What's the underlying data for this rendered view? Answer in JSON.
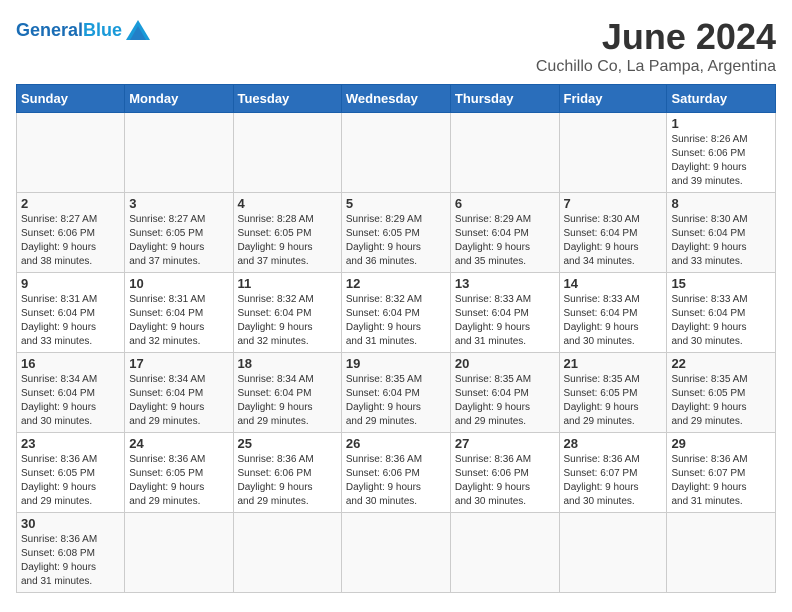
{
  "header": {
    "logo_general": "General",
    "logo_blue": "Blue",
    "month_title": "June 2024",
    "location": "Cuchillo Co, La Pampa, Argentina"
  },
  "days_of_week": [
    "Sunday",
    "Monday",
    "Tuesday",
    "Wednesday",
    "Thursday",
    "Friday",
    "Saturday"
  ],
  "weeks": [
    [
      {
        "day": "",
        "content": ""
      },
      {
        "day": "",
        "content": ""
      },
      {
        "day": "",
        "content": ""
      },
      {
        "day": "",
        "content": ""
      },
      {
        "day": "",
        "content": ""
      },
      {
        "day": "",
        "content": ""
      },
      {
        "day": "1",
        "content": "Sunrise: 8:26 AM\nSunset: 6:06 PM\nDaylight: 9 hours\nand 39 minutes."
      }
    ],
    [
      {
        "day": "2",
        "content": "Sunrise: 8:27 AM\nSunset: 6:06 PM\nDaylight: 9 hours\nand 38 minutes."
      },
      {
        "day": "3",
        "content": "Sunrise: 8:27 AM\nSunset: 6:05 PM\nDaylight: 9 hours\nand 37 minutes."
      },
      {
        "day": "4",
        "content": "Sunrise: 8:28 AM\nSunset: 6:05 PM\nDaylight: 9 hours\nand 37 minutes."
      },
      {
        "day": "5",
        "content": "Sunrise: 8:29 AM\nSunset: 6:05 PM\nDaylight: 9 hours\nand 36 minutes."
      },
      {
        "day": "6",
        "content": "Sunrise: 8:29 AM\nSunset: 6:04 PM\nDaylight: 9 hours\nand 35 minutes."
      },
      {
        "day": "7",
        "content": "Sunrise: 8:30 AM\nSunset: 6:04 PM\nDaylight: 9 hours\nand 34 minutes."
      },
      {
        "day": "8",
        "content": "Sunrise: 8:30 AM\nSunset: 6:04 PM\nDaylight: 9 hours\nand 33 minutes."
      }
    ],
    [
      {
        "day": "9",
        "content": "Sunrise: 8:31 AM\nSunset: 6:04 PM\nDaylight: 9 hours\nand 33 minutes."
      },
      {
        "day": "10",
        "content": "Sunrise: 8:31 AM\nSunset: 6:04 PM\nDaylight: 9 hours\nand 32 minutes."
      },
      {
        "day": "11",
        "content": "Sunrise: 8:32 AM\nSunset: 6:04 PM\nDaylight: 9 hours\nand 32 minutes."
      },
      {
        "day": "12",
        "content": "Sunrise: 8:32 AM\nSunset: 6:04 PM\nDaylight: 9 hours\nand 31 minutes."
      },
      {
        "day": "13",
        "content": "Sunrise: 8:33 AM\nSunset: 6:04 PM\nDaylight: 9 hours\nand 31 minutes."
      },
      {
        "day": "14",
        "content": "Sunrise: 8:33 AM\nSunset: 6:04 PM\nDaylight: 9 hours\nand 30 minutes."
      },
      {
        "day": "15",
        "content": "Sunrise: 8:33 AM\nSunset: 6:04 PM\nDaylight: 9 hours\nand 30 minutes."
      }
    ],
    [
      {
        "day": "16",
        "content": "Sunrise: 8:34 AM\nSunset: 6:04 PM\nDaylight: 9 hours\nand 30 minutes."
      },
      {
        "day": "17",
        "content": "Sunrise: 8:34 AM\nSunset: 6:04 PM\nDaylight: 9 hours\nand 29 minutes."
      },
      {
        "day": "18",
        "content": "Sunrise: 8:34 AM\nSunset: 6:04 PM\nDaylight: 9 hours\nand 29 minutes."
      },
      {
        "day": "19",
        "content": "Sunrise: 8:35 AM\nSunset: 6:04 PM\nDaylight: 9 hours\nand 29 minutes."
      },
      {
        "day": "20",
        "content": "Sunrise: 8:35 AM\nSunset: 6:04 PM\nDaylight: 9 hours\nand 29 minutes."
      },
      {
        "day": "21",
        "content": "Sunrise: 8:35 AM\nSunset: 6:05 PM\nDaylight: 9 hours\nand 29 minutes."
      },
      {
        "day": "22",
        "content": "Sunrise: 8:35 AM\nSunset: 6:05 PM\nDaylight: 9 hours\nand 29 minutes."
      }
    ],
    [
      {
        "day": "23",
        "content": "Sunrise: 8:36 AM\nSunset: 6:05 PM\nDaylight: 9 hours\nand 29 minutes."
      },
      {
        "day": "24",
        "content": "Sunrise: 8:36 AM\nSunset: 6:05 PM\nDaylight: 9 hours\nand 29 minutes."
      },
      {
        "day": "25",
        "content": "Sunrise: 8:36 AM\nSunset: 6:06 PM\nDaylight: 9 hours\nand 29 minutes."
      },
      {
        "day": "26",
        "content": "Sunrise: 8:36 AM\nSunset: 6:06 PM\nDaylight: 9 hours\nand 30 minutes."
      },
      {
        "day": "27",
        "content": "Sunrise: 8:36 AM\nSunset: 6:06 PM\nDaylight: 9 hours\nand 30 minutes."
      },
      {
        "day": "28",
        "content": "Sunrise: 8:36 AM\nSunset: 6:07 PM\nDaylight: 9 hours\nand 30 minutes."
      },
      {
        "day": "29",
        "content": "Sunrise: 8:36 AM\nSunset: 6:07 PM\nDaylight: 9 hours\nand 31 minutes."
      }
    ],
    [
      {
        "day": "30",
        "content": "Sunrise: 8:36 AM\nSunset: 6:08 PM\nDaylight: 9 hours\nand 31 minutes."
      },
      {
        "day": "",
        "content": ""
      },
      {
        "day": "",
        "content": ""
      },
      {
        "day": "",
        "content": ""
      },
      {
        "day": "",
        "content": ""
      },
      {
        "day": "",
        "content": ""
      },
      {
        "day": "",
        "content": ""
      }
    ]
  ]
}
